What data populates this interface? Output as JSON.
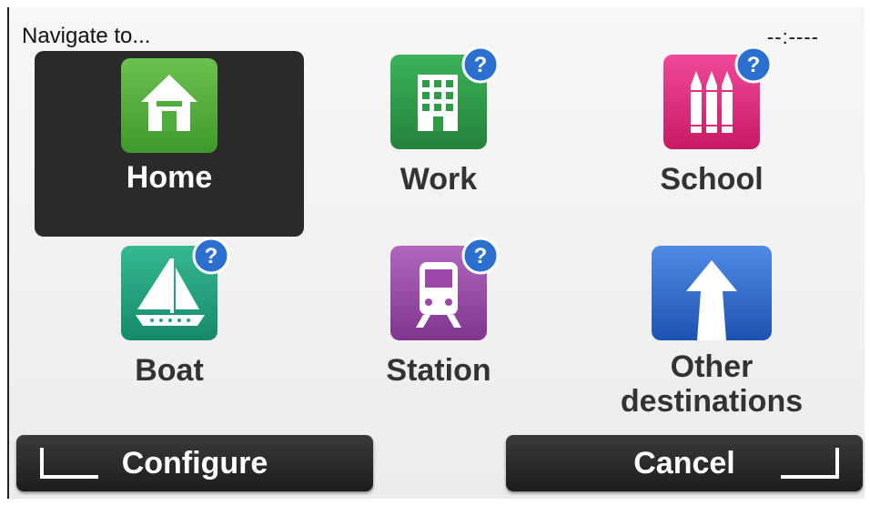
{
  "header": {
    "title": "Navigate to...",
    "clock": "--:----"
  },
  "tiles": [
    {
      "label": "Home",
      "icon": "home-icon",
      "color": "#4fae3a",
      "selected": true
    },
    {
      "label": "Work",
      "icon": "office-building-icon",
      "color": "#2f9a47",
      "badge": "?"
    },
    {
      "label": "School",
      "icon": "crayons-icon",
      "color": "#e62b7d",
      "badge": "?"
    },
    {
      "label": "Boat",
      "icon": "sailboat-icon",
      "color": "#1ea27f",
      "badge": "?"
    },
    {
      "label": "Station",
      "icon": "train-icon",
      "color": "#9a49a7",
      "badge": "?"
    },
    {
      "label": "Other destinations",
      "label_line1": "Other",
      "label_line2": "destinations",
      "icon": "arrow-up-icon",
      "color": "#2f6bd0"
    }
  ],
  "buttons": {
    "configure": "Configure",
    "cancel": "Cancel"
  },
  "colors": {
    "badge": "#2b6fd1",
    "selected_bg": "#2a2a2a",
    "button_bg": "#2b2b2b"
  }
}
